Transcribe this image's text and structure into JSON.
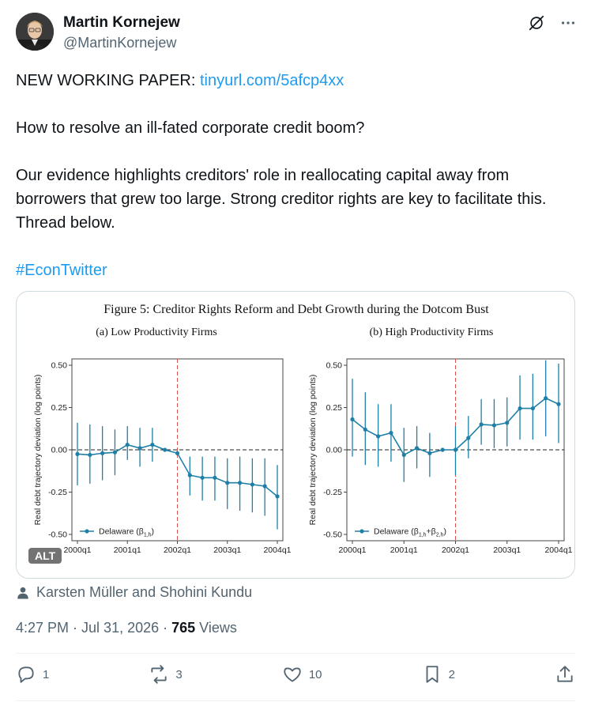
{
  "author": {
    "name": "Martin Kornejew",
    "handle": "@MartinKornejew"
  },
  "tweet": {
    "line1_prefix": "NEW WORKING PAPER: ",
    "link": "tinyurl.com/5afcp4xx",
    "para2": "How to resolve an ill-fated corporate credit boom?",
    "para3": "Our evidence highlights creditors' role in reallocating capital away from borrowers that grew too large. Strong creditor rights are key to facilitate this. Thread below.",
    "hashtag": "#EconTwitter"
  },
  "figure": {
    "title": "Figure 5: Creditor Rights Reform and Debt Growth during the Dotcom Bust",
    "alt_badge": "ALT"
  },
  "chart_data": [
    {
      "type": "line",
      "title": "(a) Low Productivity Firms",
      "ylabel": "Real debt trajectory deviation (log points)",
      "ylim": [
        -0.5,
        0.5
      ],
      "yticks": [
        "0.50",
        "0.25",
        "0.00",
        "-0.25",
        "-0.50"
      ],
      "xticks": [
        "2000q1",
        "2001q1",
        "2002q1",
        "2003q1",
        "2004q1"
      ],
      "vline": "2002q1",
      "x": [
        "2000q1",
        "2000q2",
        "2000q3",
        "2000q4",
        "2001q1",
        "2001q2",
        "2001q3",
        "2001q4",
        "2002q1",
        "2002q2",
        "2002q3",
        "2002q4",
        "2003q1",
        "2003q2",
        "2003q3",
        "2003q4",
        "2004q1"
      ],
      "series": [
        {
          "name": "Delaware (β1,h)",
          "color": "#1f7fa6",
          "values": [
            -0.025,
            -0.03,
            -0.02,
            -0.015,
            0.03,
            0.01,
            0.03,
            0.0,
            -0.02,
            -0.15,
            -0.165,
            -0.165,
            -0.195,
            -0.195,
            -0.205,
            -0.215,
            -0.275
          ],
          "lower": [
            -0.21,
            -0.2,
            -0.18,
            -0.15,
            -0.06,
            -0.1,
            -0.07,
            -0.01,
            -0.02,
            -0.27,
            -0.3,
            -0.3,
            -0.35,
            -0.36,
            -0.37,
            -0.39,
            -0.47
          ],
          "upper": [
            0.16,
            0.15,
            0.14,
            0.12,
            0.14,
            0.13,
            0.13,
            0.01,
            -0.02,
            -0.04,
            -0.04,
            -0.04,
            -0.05,
            -0.04,
            -0.05,
            -0.05,
            -0.09
          ]
        }
      ],
      "legend": {
        "label_base": "Delaware (β",
        "sub": "1,h",
        "after": ")"
      }
    },
    {
      "type": "line",
      "title": "(b) High Productivity Firms",
      "ylabel": "Real debt trajectory deviation (log points)",
      "ylim": [
        -0.5,
        0.5
      ],
      "yticks": [
        "0.50",
        "0.25",
        "0.00",
        "-0.25",
        "-0.50"
      ],
      "xticks": [
        "2000q1",
        "2001q1",
        "2002q1",
        "2003q1",
        "2004q1"
      ],
      "vline": "2002q1",
      "x": [
        "2000q1",
        "2000q2",
        "2000q3",
        "2000q4",
        "2001q1",
        "2001q2",
        "2001q3",
        "2001q4",
        "2002q1",
        "2002q2",
        "2002q3",
        "2002q4",
        "2003q1",
        "2003q2",
        "2003q3",
        "2003q4",
        "2004q1"
      ],
      "series": [
        {
          "name": "Delaware (β1,h+β2,h)",
          "color": "#1f7fa6",
          "values": [
            0.18,
            0.12,
            0.08,
            0.1,
            -0.03,
            0.01,
            -0.02,
            0.0,
            0.0,
            0.07,
            0.15,
            0.145,
            0.16,
            0.245,
            0.245,
            0.305,
            0.27
          ],
          "lower": [
            -0.04,
            -0.09,
            -0.1,
            -0.07,
            -0.19,
            -0.11,
            -0.16,
            0.0,
            -0.15,
            -0.05,
            0.03,
            0.01,
            0.02,
            0.06,
            0.06,
            0.08,
            0.04
          ],
          "upper": [
            0.42,
            0.34,
            0.27,
            0.27,
            0.13,
            0.14,
            0.1,
            0.0,
            0.14,
            0.2,
            0.3,
            0.3,
            0.31,
            0.44,
            0.45,
            0.53,
            0.51
          ]
        }
      ],
      "legend": {
        "label_base": "Delaware (β",
        "sub": "1,h",
        "mid": "+β",
        "sub2": "2,h",
        "after": ")"
      }
    }
  ],
  "credits": {
    "text": "Karsten Müller and Shohini Kundu"
  },
  "meta": {
    "time": "4:27 PM",
    "sep": " · ",
    "date": "Jul 31, 2026",
    "views_count": "765",
    "views_label": " Views"
  },
  "actions": {
    "replies": "1",
    "reposts": "3",
    "likes": "10",
    "bookmarks": "2"
  }
}
